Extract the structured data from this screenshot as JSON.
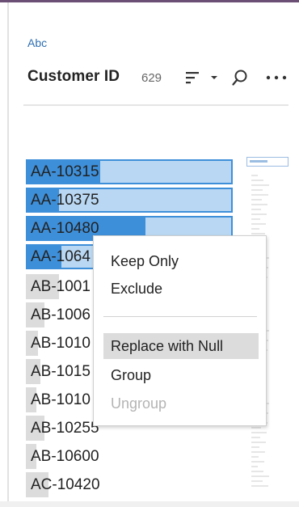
{
  "field": {
    "type_label": "Abc",
    "name": "Customer ID",
    "count": "629"
  },
  "header_icons": {
    "sort": "sort-icon",
    "caret": "chevron-down-icon",
    "search": "search-icon",
    "more": "more-icon"
  },
  "values": [
    {
      "label": "AA-10315",
      "selected": true,
      "share": 0.36
    },
    {
      "label": "AA-10375",
      "selected": true,
      "share": 0.16
    },
    {
      "label": "AA-10480",
      "selected": true,
      "share": 0.58
    },
    {
      "label": "AA-1064",
      "selected": true,
      "share": 0.17
    },
    {
      "label": "AB-1001",
      "selected": false,
      "share": 0.16
    },
    {
      "label": "AB-1006",
      "selected": false,
      "share": 0.09
    },
    {
      "label": "AB-1010",
      "selected": false,
      "share": 0.06
    },
    {
      "label": "AB-1015",
      "selected": false,
      "share": 0.07
    },
    {
      "label": "AB-1010",
      "selected": false,
      "share": 0.05
    },
    {
      "label": "AB-10255",
      "selected": false,
      "share": 0.09
    },
    {
      "label": "AB-10600",
      "selected": false,
      "share": 0.05
    },
    {
      "label": "AC-10420",
      "selected": false,
      "share": 0.11
    }
  ],
  "context_menu": {
    "items": [
      {
        "label": "Keep Only",
        "state": "normal"
      },
      {
        "label": "Exclude",
        "state": "normal"
      },
      {
        "label": "Replace with Null",
        "state": "hover"
      },
      {
        "label": "Group",
        "state": "normal"
      },
      {
        "label": "Ungroup",
        "state": "disabled"
      }
    ]
  },
  "colors": {
    "accent": "#3e8fd9",
    "selected_light": "#b9d7f2",
    "unselected_bar": "#dcdcdc",
    "type_label": "#2f6fb2"
  }
}
